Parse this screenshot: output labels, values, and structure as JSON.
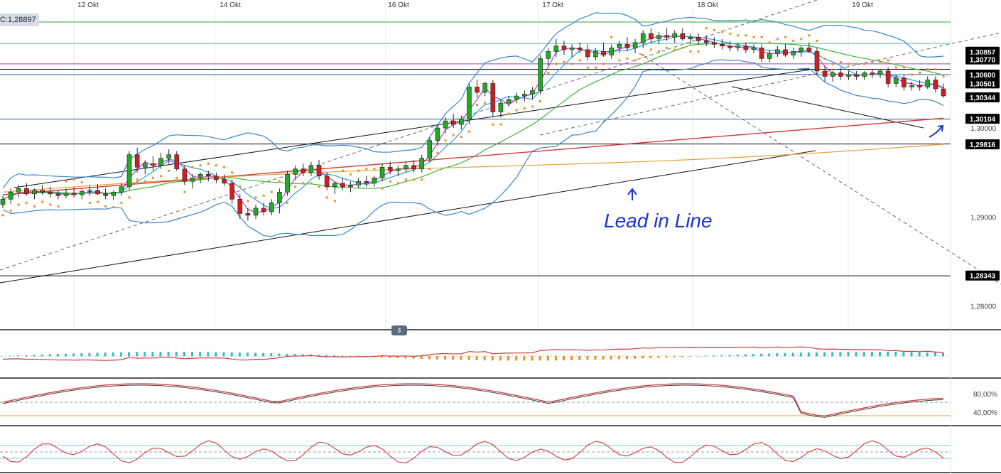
{
  "header": {
    "price_badge": "C:1,28897"
  },
  "annotation": {
    "text": "Lead in Line",
    "color": "#1a35c8"
  },
  "colors": {
    "bull": "#22aa22",
    "bear": "#cc1f1f",
    "bollinger": "#3a86c8",
    "ema_fast": "#b23fd0",
    "ema_mid": "#2e9edb",
    "sma_green": "#3cb43c",
    "sma_red": "#d43a3a",
    "sma_orange": "#e8a13a",
    "sar": "#f28c1e",
    "label_bg": "#000000",
    "label_fg": "#ffffff"
  },
  "icons": [
    "pane-resize-handle-icon",
    "annotation-arrow-icon"
  ],
  "chart_data": [
    {
      "type": "candlestick",
      "pane": "main",
      "x_ticks": [
        "12 Okt",
        "14 Okt",
        "16 Okt",
        "17 Okt",
        "18 Okt",
        "19 Okt"
      ],
      "y_ticks": [
        "1,30000",
        "1,29000",
        "1,28000"
      ],
      "ylim": [
        1.2775,
        1.3135
      ],
      "price_labels": [
        "1,30857",
        "1,30770",
        "1,30600",
        "1,30501",
        "1,30344",
        "1,30104",
        "1,29816",
        "1,28343"
      ],
      "price_levels": [
        1.30857,
        1.3077,
        1.306,
        1.30501,
        1.30344,
        1.30104,
        1.29816,
        1.28343
      ],
      "horizontal_lines": [
        {
          "value": 1.3119,
          "color": "#33aa33"
        },
        {
          "value": 1.3095,
          "color": "#5bbaa8"
        },
        {
          "value": 1.3072,
          "color": "#9b3fc9"
        },
        {
          "value": 1.3066,
          "color": "#111111"
        },
        {
          "value": 1.306,
          "color": "#245fa8"
        },
        {
          "value": 1.301,
          "color": "#245fa8"
        },
        {
          "value": 1.2982,
          "color": "#111111"
        },
        {
          "value": 1.2834,
          "color": "#111111"
        }
      ],
      "candles_ohlc": [
        [
          1.2914,
          1.2924,
          1.291,
          1.292
        ],
        [
          1.292,
          1.2932,
          1.2915,
          1.2928
        ],
        [
          1.2928,
          1.2936,
          1.2922,
          1.2932
        ],
        [
          1.2932,
          1.2938,
          1.2924,
          1.2926
        ],
        [
          1.2926,
          1.2932,
          1.292,
          1.293
        ],
        [
          1.293,
          1.2936,
          1.2925,
          1.2928
        ],
        [
          1.2928,
          1.2934,
          1.2922,
          1.2926
        ],
        [
          1.2926,
          1.293,
          1.292,
          1.2924
        ],
        [
          1.2924,
          1.2932,
          1.2921,
          1.2927
        ],
        [
          1.2927,
          1.2934,
          1.2922,
          1.2925
        ],
        [
          1.2925,
          1.2931,
          1.292,
          1.2929
        ],
        [
          1.2929,
          1.2936,
          1.2924,
          1.293
        ],
        [
          1.293,
          1.2937,
          1.2925,
          1.2926
        ],
        [
          1.2926,
          1.2932,
          1.292,
          1.2924
        ],
        [
          1.2924,
          1.293,
          1.2919,
          1.2928
        ],
        [
          1.2928,
          1.2938,
          1.2924,
          1.2934
        ],
        [
          1.2934,
          1.2974,
          1.293,
          1.297
        ],
        [
          1.297,
          1.2978,
          1.295,
          1.2956
        ],
        [
          1.2956,
          1.2964,
          1.2948,
          1.296
        ],
        [
          1.296,
          1.2968,
          1.2952,
          1.2958
        ],
        [
          1.2958,
          1.2972,
          1.2954,
          1.2966
        ],
        [
          1.2966,
          1.2976,
          1.296,
          1.297
        ],
        [
          1.297,
          1.2974,
          1.2952,
          1.2954
        ],
        [
          1.2954,
          1.2958,
          1.2936,
          1.294
        ],
        [
          1.294,
          1.2948,
          1.2932,
          1.2944
        ],
        [
          1.2944,
          1.295,
          1.2938,
          1.2948
        ],
        [
          1.2948,
          1.2952,
          1.294,
          1.2946
        ],
        [
          1.2946,
          1.295,
          1.2938,
          1.2942
        ],
        [
          1.2942,
          1.2948,
          1.2935,
          1.2938
        ],
        [
          1.2938,
          1.2942,
          1.2915,
          1.292
        ],
        [
          1.292,
          1.2926,
          1.2898,
          1.2904
        ],
        [
          1.2904,
          1.291,
          1.2896,
          1.2902
        ],
        [
          1.2902,
          1.2914,
          1.2898,
          1.291
        ],
        [
          1.291,
          1.2916,
          1.2902,
          1.2906
        ],
        [
          1.2906,
          1.292,
          1.2902,
          1.2916
        ],
        [
          1.2916,
          1.2932,
          1.2904,
          1.2928
        ],
        [
          1.2928,
          1.2952,
          1.2924,
          1.2948
        ],
        [
          1.2948,
          1.2958,
          1.2942,
          1.2954
        ],
        [
          1.2954,
          1.296,
          1.2946,
          1.295
        ],
        [
          1.295,
          1.2962,
          1.2946,
          1.2958
        ],
        [
          1.2958,
          1.2964,
          1.2942,
          1.2946
        ],
        [
          1.2946,
          1.295,
          1.293,
          1.2934
        ],
        [
          1.2934,
          1.294,
          1.2926,
          1.2938
        ],
        [
          1.2938,
          1.2944,
          1.293,
          1.2934
        ],
        [
          1.2934,
          1.294,
          1.2928,
          1.2936
        ],
        [
          1.2936,
          1.2944,
          1.2932,
          1.294
        ],
        [
          1.294,
          1.2946,
          1.2934,
          1.2938
        ],
        [
          1.2938,
          1.2946,
          1.2934,
          1.2944
        ],
        [
          1.2944,
          1.296,
          1.294,
          1.2956
        ],
        [
          1.2956,
          1.2962,
          1.2948,
          1.2952
        ],
        [
          1.2952,
          1.2958,
          1.2946,
          1.2954
        ],
        [
          1.2954,
          1.2962,
          1.295,
          1.2958
        ],
        [
          1.2958,
          1.2964,
          1.295,
          1.2954
        ],
        [
          1.2954,
          1.297,
          1.295,
          1.2966
        ],
        [
          1.2966,
          1.299,
          1.2962,
          1.2986
        ],
        [
          1.2986,
          1.3004,
          1.298,
          1.3
        ],
        [
          1.3,
          1.3012,
          1.2994,
          1.3008
        ],
        [
          1.3008,
          1.3016,
          1.3,
          1.3004
        ],
        [
          1.3004,
          1.3014,
          1.2998,
          1.301
        ],
        [
          1.301,
          1.305,
          1.3004,
          1.3046
        ],
        [
          1.3046,
          1.3054,
          1.3034,
          1.304
        ],
        [
          1.304,
          1.3052,
          1.3036,
          1.305
        ],
        [
          1.305,
          1.3054,
          1.3012,
          1.3018
        ],
        [
          1.3018,
          1.3032,
          1.3012,
          1.3028
        ],
        [
          1.3028,
          1.3036,
          1.3024,
          1.3032
        ],
        [
          1.3032,
          1.304,
          1.3028,
          1.3036
        ],
        [
          1.3036,
          1.3042,
          1.303,
          1.3038
        ],
        [
          1.3038,
          1.3046,
          1.3032,
          1.3042
        ],
        [
          1.3042,
          1.3082,
          1.3038,
          1.3078
        ],
        [
          1.3078,
          1.309,
          1.307,
          1.3086
        ],
        [
          1.3086,
          1.31,
          1.308,
          1.3092
        ],
        [
          1.3092,
          1.3098,
          1.3082,
          1.3088
        ],
        [
          1.3088,
          1.3094,
          1.308,
          1.309
        ],
        [
          1.309,
          1.3096,
          1.3084,
          1.3088
        ],
        [
          1.3088,
          1.3094,
          1.3076,
          1.308
        ],
        [
          1.308,
          1.309,
          1.3076,
          1.3086
        ],
        [
          1.3086,
          1.3096,
          1.308,
          1.3082
        ],
        [
          1.3082,
          1.3094,
          1.3078,
          1.309
        ],
        [
          1.309,
          1.3098,
          1.3084,
          1.3094
        ],
        [
          1.3094,
          1.3102,
          1.3086,
          1.309
        ],
        [
          1.309,
          1.31,
          1.3084,
          1.3096
        ],
        [
          1.3096,
          1.311,
          1.309,
          1.3106
        ],
        [
          1.3106,
          1.3112,
          1.3096,
          1.31
        ],
        [
          1.31,
          1.3108,
          1.3094,
          1.3104
        ],
        [
          1.3104,
          1.3112,
          1.3098,
          1.3102
        ],
        [
          1.3102,
          1.311,
          1.3096,
          1.3106
        ],
        [
          1.3106,
          1.3112,
          1.3098,
          1.31
        ],
        [
          1.31,
          1.3106,
          1.3094,
          1.3102
        ],
        [
          1.3102,
          1.3106,
          1.3094,
          1.3098
        ],
        [
          1.3098,
          1.3104,
          1.3092,
          1.3096
        ],
        [
          1.3096,
          1.3102,
          1.309,
          1.3094
        ],
        [
          1.3094,
          1.31,
          1.3088,
          1.3092
        ],
        [
          1.3092,
          1.3098,
          1.3086,
          1.309
        ],
        [
          1.309,
          1.3096,
          1.3086,
          1.3092
        ],
        [
          1.3092,
          1.3096,
          1.3084,
          1.3088
        ],
        [
          1.3088,
          1.3094,
          1.3084,
          1.309
        ],
        [
          1.309,
          1.3094,
          1.3074,
          1.3078
        ],
        [
          1.3078,
          1.3088,
          1.3074,
          1.3084
        ],
        [
          1.3084,
          1.3092,
          1.308,
          1.3088
        ],
        [
          1.3088,
          1.3094,
          1.308,
          1.3082
        ],
        [
          1.3082,
          1.309,
          1.3078,
          1.3086
        ],
        [
          1.3086,
          1.3092,
          1.308,
          1.309
        ],
        [
          1.309,
          1.3096,
          1.3084,
          1.3086
        ],
        [
          1.3086,
          1.309,
          1.306,
          1.3064
        ],
        [
          1.3064,
          1.307,
          1.3052,
          1.3058
        ],
        [
          1.3058,
          1.3064,
          1.3052,
          1.3062
        ],
        [
          1.3062,
          1.3066,
          1.3054,
          1.3058
        ],
        [
          1.3058,
          1.3064,
          1.3054,
          1.306
        ],
        [
          1.306,
          1.3064,
          1.3054,
          1.3058
        ],
        [
          1.3058,
          1.3064,
          1.3054,
          1.3062
        ],
        [
          1.3062,
          1.3066,
          1.3056,
          1.306
        ],
        [
          1.306,
          1.3066,
          1.3056,
          1.3064
        ],
        [
          1.3064,
          1.3068,
          1.3046,
          1.305
        ],
        [
          1.305,
          1.306,
          1.3046,
          1.3056
        ],
        [
          1.3056,
          1.306,
          1.3042,
          1.3046
        ],
        [
          1.3046,
          1.3052,
          1.3042,
          1.3048
        ],
        [
          1.3048,
          1.3054,
          1.3042,
          1.3046
        ],
        [
          1.3046,
          1.3058,
          1.3044,
          1.3054
        ],
        [
          1.3054,
          1.3058,
          1.304,
          1.3044
        ],
        [
          1.3044,
          1.305,
          1.3034,
          1.3036
        ]
      ],
      "overlays": [
        {
          "name": "bollinger",
          "series_note": "upper/middle/lower bands"
        },
        {
          "name": "parabolic_sar"
        },
        {
          "name": "moving_averages",
          "count": 5
        }
      ]
    },
    {
      "type": "histogram_line",
      "pane": "indicator_1"
    },
    {
      "type": "line",
      "pane": "indicator_2",
      "y_ticks": [
        "80,00%",
        "40,00%"
      ],
      "ylim": [
        0,
        100
      ]
    },
    {
      "type": "line",
      "pane": "indicator_3"
    }
  ]
}
